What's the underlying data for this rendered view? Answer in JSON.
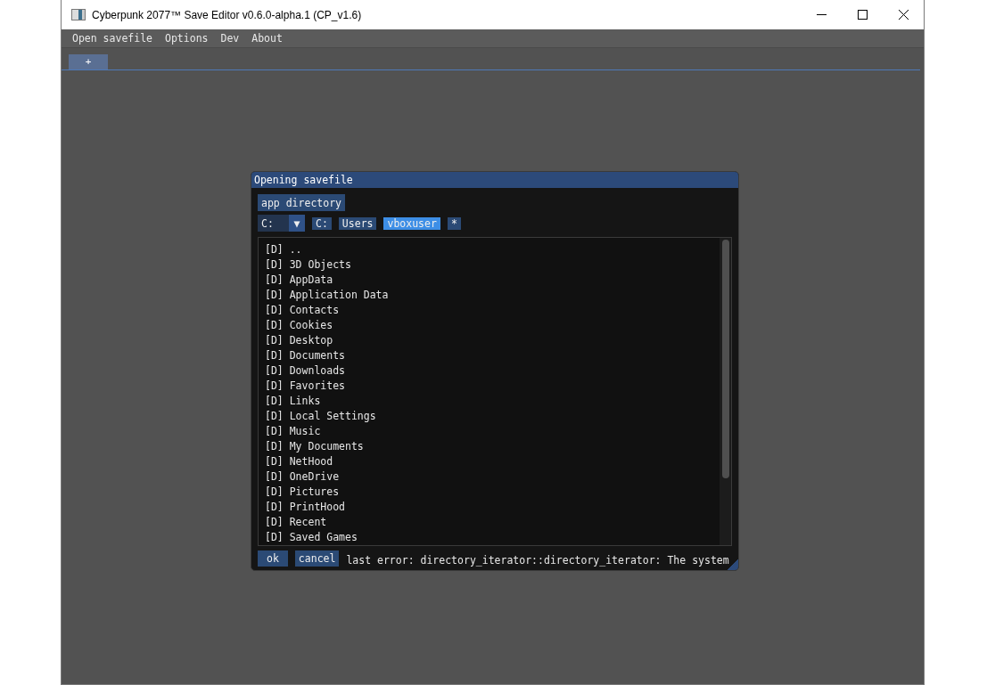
{
  "window": {
    "title": "Cyberpunk 2077™ Save Editor v0.6.0-alpha.1 (CP_v1.6)"
  },
  "menu": [
    "Open savefile",
    "Options",
    "Dev",
    "About"
  ],
  "tabs": [
    {
      "label": "+",
      "selected": true
    }
  ],
  "dialog": {
    "title": "Opening savefile",
    "app_directory_button": "app directory",
    "drive": {
      "value": "C:",
      "arrow": "▼"
    },
    "breadcrumbs": [
      {
        "label": "C:",
        "selected": false
      },
      {
        "label": "Users",
        "selected": false
      },
      {
        "label": "vboxuser",
        "selected": true
      },
      {
        "label": "*",
        "selected": false
      }
    ],
    "entries": [
      "[D] ..",
      "[D] 3D Objects",
      "[D] AppData",
      "[D] Application Data",
      "[D] Contacts",
      "[D] Cookies",
      "[D] Desktop",
      "[D] Documents",
      "[D] Downloads",
      "[D] Favorites",
      "[D] Links",
      "[D] Local Settings",
      "[D] Music",
      "[D] My Documents",
      "[D] NetHood",
      "[D] OneDrive",
      "[D] Pictures",
      "[D] PrintHood",
      "[D] Recent",
      "[D] Saved Games"
    ],
    "buttons": [
      "ok",
      "cancel"
    ],
    "status": "last error: directory_iterator::directory_iterator: The system"
  }
}
